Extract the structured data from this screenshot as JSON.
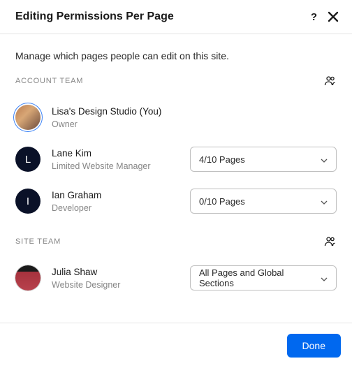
{
  "header": {
    "title": "Editing Permissions Per Page"
  },
  "subtitle": "Manage which pages people can edit on this site.",
  "sections": {
    "account": {
      "label": "ACCOUNT TEAM"
    },
    "site": {
      "label": "SITE TEAM"
    }
  },
  "members": {
    "lisa": {
      "name": "Lisa's Design Studio (You)",
      "role": "Owner"
    },
    "lane": {
      "name": "Lane Kim",
      "role": "Limited Website Manager",
      "initial": "L",
      "pages": "4/10 Pages"
    },
    "ian": {
      "name": "Ian Graham",
      "role": "Developer",
      "initial": "I",
      "pages": "0/10 Pages"
    },
    "julia": {
      "name": "Julia Shaw",
      "role": "Website Designer",
      "pages": "All Pages and Global Sections"
    }
  },
  "footer": {
    "done": "Done"
  }
}
